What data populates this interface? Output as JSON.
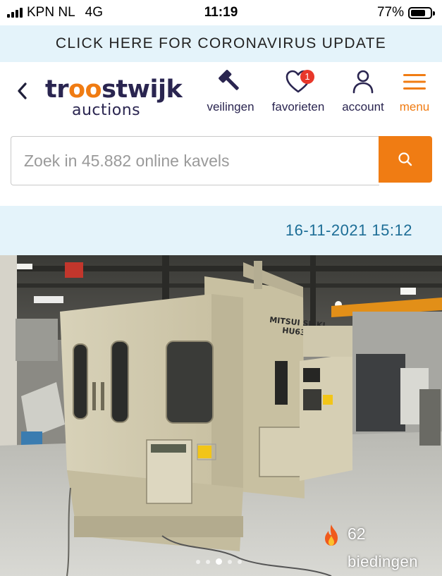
{
  "status_bar": {
    "carrier": "KPN NL",
    "network": "4G",
    "time": "11:19",
    "battery": "77%",
    "battery_level": 0.77
  },
  "banner": {
    "text": "CLICK HERE FOR CORONAVIRUS UPDATE"
  },
  "header": {
    "back_icon": "chevron-left-icon",
    "logo": {
      "brand_top": "troostwijk",
      "brand_bottom": "auctions",
      "accent_color": "#f07c13",
      "brand_color": "#2a2550"
    },
    "nav": [
      {
        "label": "veilingen",
        "icon": "gavel-icon"
      },
      {
        "label": "favorieten",
        "icon": "heart-icon",
        "badge": "1"
      },
      {
        "label": "account",
        "icon": "user-icon"
      },
      {
        "label": "menu",
        "icon": "hamburger-icon"
      }
    ]
  },
  "search": {
    "placeholder": "Zoek in 45.882 online kavels",
    "value": "",
    "button_icon": "search-icon",
    "button_color": "#f07c13"
  },
  "lot": {
    "date": "16-11-2021 15:12",
    "photo_alt": "MITSUI SEIKI HU63A",
    "machine_label_1": "MITSUI SEIKI",
    "machine_label_2": "HU63A",
    "bids_count": "62",
    "bids_label": "biedingen",
    "bids_icon": "flame-icon",
    "carousel_total": 5,
    "carousel_active": 3
  }
}
